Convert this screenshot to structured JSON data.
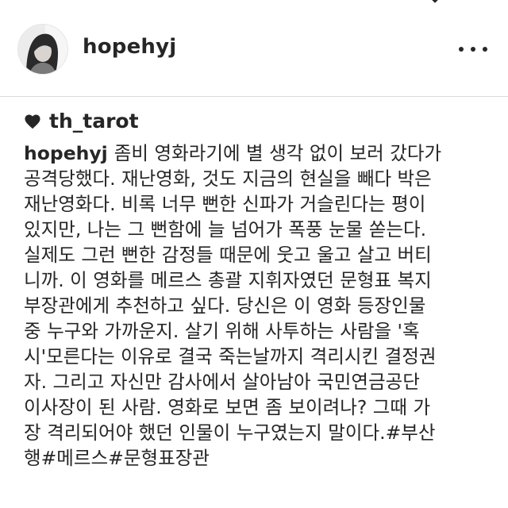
{
  "header": {
    "username": "hopehyj",
    "more_icon": "more-horizontal-icon"
  },
  "likes": {
    "icon": "heart-icon",
    "liked_by": "th_tarot"
  },
  "caption": {
    "username": "hopehyj",
    "lines": [
      "좀비 영화라기에 별 생각 없이 보러 갔다가",
      "공격당했다. 재난영화, 것도 지금의 현실을 빼다 박은",
      "재난영화다. 비록 너무 뻔한 신파가 거슬린다는 평이",
      "있지만, 나는 그 뻔함에 늘 넘어가 폭풍 눈물 쏟는다.",
      "실제도 그런 뻔한 감정들 때문에 웃고 울고 살고 버티",
      "니까. 이 영화를 메르스 총괄 지휘자였던 문형표 복지",
      "부장관에게 추천하고 싶다. 당신은 이 영화 등장인물",
      "중 누구와 가까운지. 살기 위해 사투하는 사람을 '혹",
      "시'모른다는 이유로 결국 죽는날까지 격리시킨 결정권",
      "자. 그리고 자신만 감사에서 살아남아 국민연금공단",
      "이사장이 된 사람. 영화로 보면 좀 보이려나? 그때 가",
      "장 격리되어야 했던 인물이 누구였는지 말이다.#부산",
      "행#메르스#문형표장관"
    ]
  },
  "colors": {
    "text": "#262626",
    "divider": "#dbdbdb",
    "background": "#ffffff"
  }
}
